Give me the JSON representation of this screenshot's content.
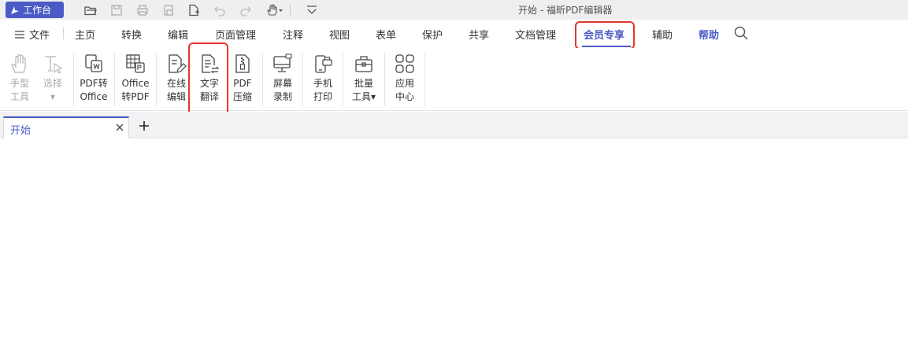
{
  "titlebar": {
    "workbench_label": "工作台",
    "window_title": "开始 - 福昕PDF编辑器"
  },
  "menu": {
    "file_label": "文件",
    "tabs": [
      "主页",
      "转换",
      "编辑",
      "页面管理",
      "注释",
      "视图",
      "表单",
      "保护",
      "共享",
      "文档管理",
      "会员专享",
      "辅助",
      "帮助"
    ],
    "active_tab": "会员专享"
  },
  "ribbon": {
    "hand_tool": [
      "手型",
      "工具"
    ],
    "select_tool": [
      "选择",
      "▾"
    ],
    "pdf_to_office": [
      "PDF转",
      "Office"
    ],
    "office_to_pdf": [
      "Office",
      "转PDF"
    ],
    "online_edit": [
      "在线",
      "编辑"
    ],
    "text_translate": [
      "文字",
      "翻译"
    ],
    "pdf_compress": [
      "PDF",
      "压缩"
    ],
    "screen_record": [
      "屏幕",
      "录制"
    ],
    "phone_print": [
      "手机",
      "打印"
    ],
    "batch_tools": [
      "批量",
      "工具▾"
    ],
    "app_center": [
      "应用",
      "中心"
    ]
  },
  "doctabs": {
    "current": "开始"
  },
  "colors": {
    "accent": "#4b5bc6",
    "highlight": "#e0392c"
  }
}
